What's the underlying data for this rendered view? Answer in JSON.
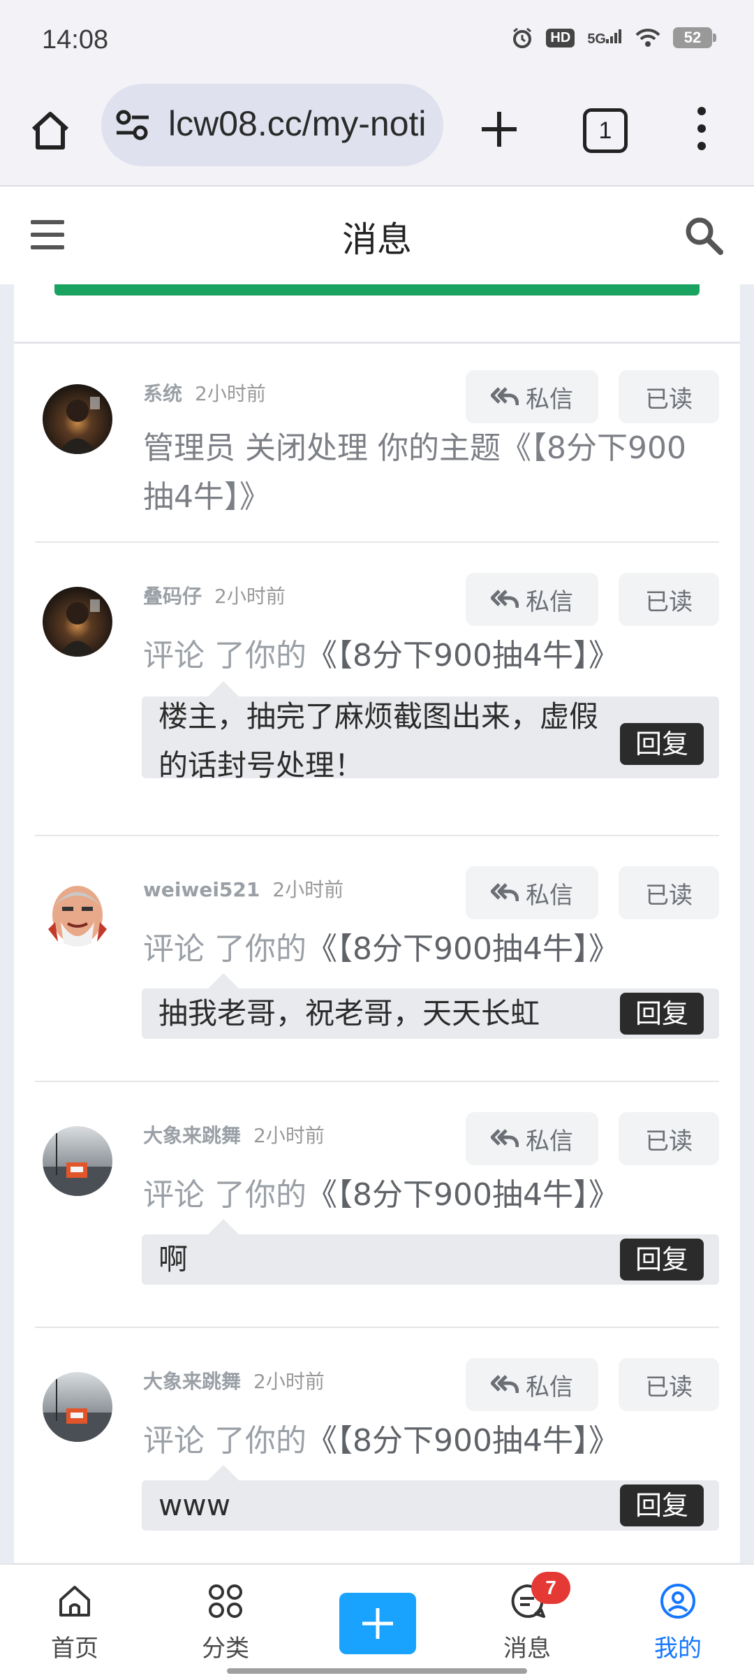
{
  "status_bar": {
    "time": "14:08",
    "hd": "HD",
    "network": "5G",
    "battery": "52"
  },
  "browser": {
    "url": "lcw08.cc/my-noti",
    "tab_count": "1"
  },
  "header": {
    "title": "消息"
  },
  "buttons": {
    "pm": "私信",
    "read": "已读",
    "reply": "回复"
  },
  "messages": [
    {
      "user": "系统",
      "time": "2小时前",
      "text": "管理员 关闭处理 你的主题《【8分下900抽4牛】》"
    },
    {
      "user": "叠码仔",
      "time": "2小时前",
      "action": "评论 了你的",
      "topic": "《【8分下900抽4牛】》",
      "comment": "楼主，抽完了麻烦截图出来，虚假的话封号处理！"
    },
    {
      "user": "weiwei521",
      "time": "2小时前",
      "action": "评论 了你的",
      "topic": "《【8分下900抽4牛】》",
      "comment": "抽我老哥，祝老哥，天天长虹"
    },
    {
      "user": "大象来跳舞",
      "time": "2小时前",
      "action": "评论 了你的",
      "topic": "《【8分下900抽4牛】》",
      "comment": "啊"
    },
    {
      "user": "大象来跳舞",
      "time": "2小时前",
      "action": "评论 了你的",
      "topic": "《【8分下900抽4牛】》",
      "comment": "www"
    }
  ],
  "bottom_nav": [
    {
      "label": "首页",
      "icon": "home-icon"
    },
    {
      "label": "分类",
      "icon": "grid-icon"
    },
    {
      "label": "",
      "icon": "add-icon"
    },
    {
      "label": "消息",
      "icon": "chat-icon",
      "badge": "7"
    },
    {
      "label": "我的",
      "icon": "profile-icon"
    }
  ],
  "colors": {
    "accent_green": "#1aa260",
    "nav_active": "#1677ff",
    "add_button": "#19a3ff",
    "badge": "#e53935"
  }
}
